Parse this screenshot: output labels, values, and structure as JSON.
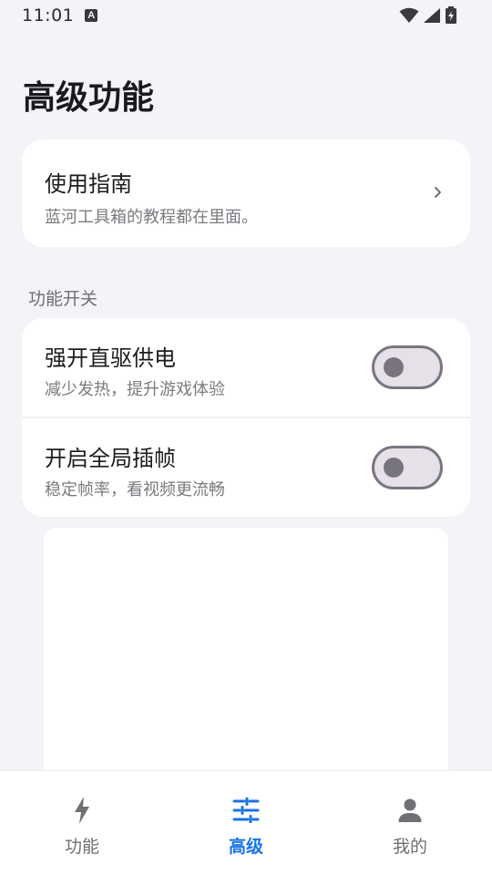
{
  "status_bar": {
    "time": "11:01",
    "notification_icon": "A",
    "icons": [
      "wifi-icon",
      "signal-icon",
      "battery-charging-icon"
    ]
  },
  "page": {
    "title": "高级功能"
  },
  "guide": {
    "title": "使用指南",
    "subtitle": "蓝河工具箱的教程都在里面。"
  },
  "switches_section": {
    "label": "功能开关",
    "items": [
      {
        "title": "强开直驱供电",
        "subtitle": "减少发热，提升游戏体验",
        "enabled": false
      },
      {
        "title": "开启全局插帧",
        "subtitle": "稳定帧率，看视频更流畅",
        "enabled": false
      }
    ]
  },
  "bottom_nav": {
    "items": [
      {
        "label": "功能",
        "icon": "flash-icon",
        "active": false
      },
      {
        "label": "高级",
        "icon": "tune-icon",
        "active": true
      },
      {
        "label": "我的",
        "icon": "person-icon",
        "active": false
      }
    ]
  },
  "colors": {
    "background": "#f3f4f8",
    "card": "#ffffff",
    "accent": "#1a73e8",
    "inactive": "#6f6f75",
    "toggle_track": "#e6e0e9",
    "toggle_outline": "#7a7680"
  }
}
